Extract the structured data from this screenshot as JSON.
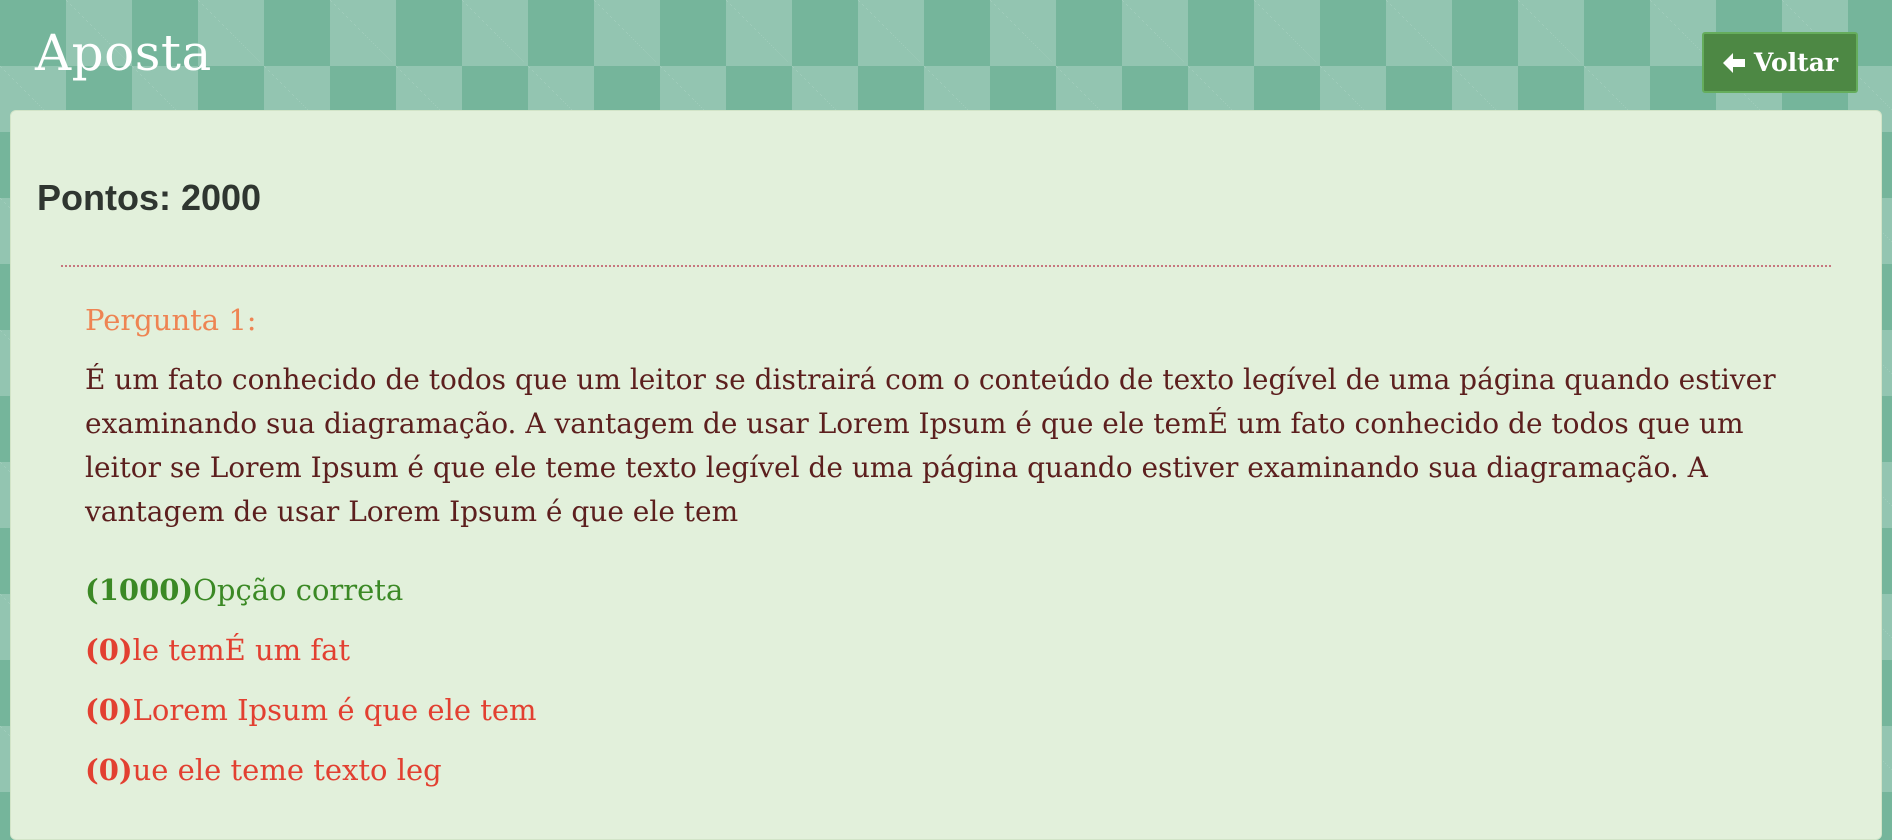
{
  "header": {
    "title": "Aposta",
    "back_label": "Voltar",
    "back_icon": "arrow-left-icon"
  },
  "score": {
    "text": "Pontos: 2000"
  },
  "question": {
    "label": "Pergunta 1:",
    "text": "É um fato conhecido de todos que um leitor se distrairá com o conteúdo de texto legível de uma página quando estiver examinando sua diagramação. A vantagem de usar Lorem Ipsum é que ele temÉ um fato conhecido de todos que um leitor se Lorem Ipsum é que ele teme texto legível de uma página quando estiver examinando sua diagramação. A vantagem de usar Lorem Ipsum é que ele tem",
    "options": [
      {
        "points": "(1000)",
        "text": "Opção correta",
        "status": "correct"
      },
      {
        "points": "(0)",
        "text": "le temÉ um fat",
        "status": "wrong"
      },
      {
        "points": "(0)",
        "text": "Lorem Ipsum é que ele tem",
        "status": "wrong"
      },
      {
        "points": "(0)",
        "text": "ue ele teme texto leg",
        "status": "wrong"
      }
    ]
  },
  "colors": {
    "background": "#75b59b",
    "panel": "#e2f0db",
    "back_button": "#4d8844",
    "question_label": "#ee8453",
    "question_text": "#5c1f1e",
    "option_correct": "#3b8925",
    "option_wrong": "#e24031"
  }
}
